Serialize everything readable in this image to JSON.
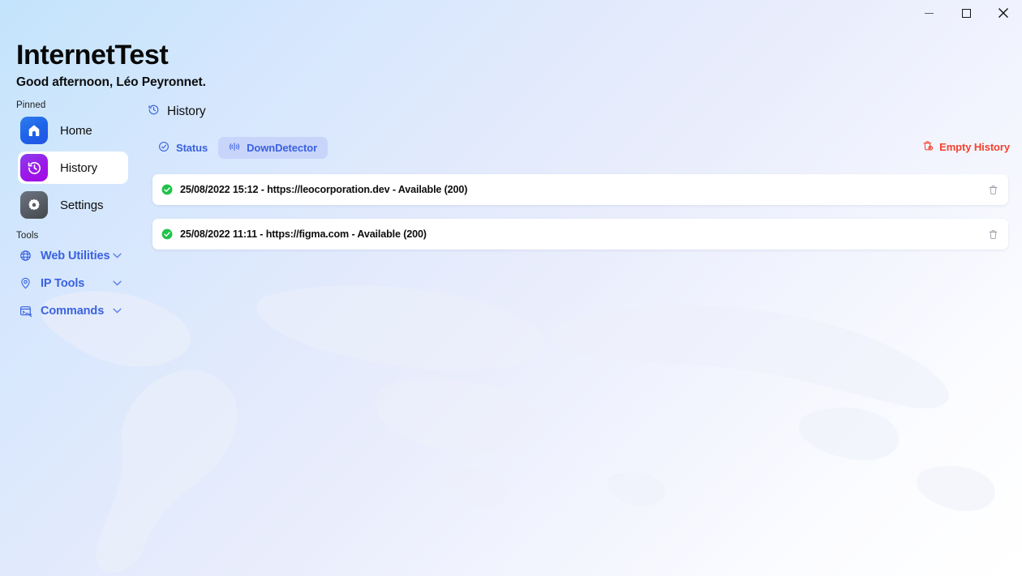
{
  "window": {
    "minimize_label": "Minimize",
    "maximize_label": "Maximize",
    "close_label": "Close"
  },
  "header": {
    "app_title": "InternetTest",
    "greeting": "Good afternoon, Léo Peyronnet."
  },
  "sidebar": {
    "pinned_label": "Pinned",
    "tools_label": "Tools",
    "pinned": [
      {
        "label": "Home",
        "icon": "home-icon",
        "selected": false
      },
      {
        "label": "History",
        "icon": "history-icon",
        "selected": true
      },
      {
        "label": "Settings",
        "icon": "gear-icon",
        "selected": false
      }
    ],
    "tools": [
      {
        "label": "Web Utilities",
        "icon": "globe-icon",
        "chevron": "chevron-down-icon"
      },
      {
        "label": "IP Tools",
        "icon": "location-pin-icon",
        "chevron": "chevron-down-icon"
      },
      {
        "label": "Commands",
        "icon": "terminal-icon",
        "chevron": "chevron-down-icon"
      }
    ]
  },
  "main": {
    "page_title": "History",
    "page_title_icon": "history-icon",
    "tabs": [
      {
        "label": "Status",
        "icon": "check-circle-icon",
        "selected": false
      },
      {
        "label": "DownDetector",
        "icon": "signal-icon",
        "selected": true
      }
    ],
    "empty_history": {
      "label": "Empty History",
      "icon": "trash-clock-icon"
    },
    "history_items": [
      {
        "text": "25/08/2022 15:12 - https://leocorporation.dev - Available (200)",
        "status": "available",
        "status_icon": "check-circle-filled-icon",
        "delete_icon": "trash-icon"
      },
      {
        "text": "25/08/2022 11:11 - https://figma.com - Available (200)",
        "status": "available",
        "status_icon": "check-circle-filled-icon",
        "delete_icon": "trash-icon"
      }
    ]
  },
  "colors": {
    "accent_blue": "#3a62e0",
    "tab_selected_bg": "#c9d4fb",
    "danger_red": "#f6422d",
    "status_green": "#1fc24a",
    "home_tile": "#1e63e8",
    "history_tile": "#9b18e8",
    "settings_tile": "#5a6069"
  }
}
